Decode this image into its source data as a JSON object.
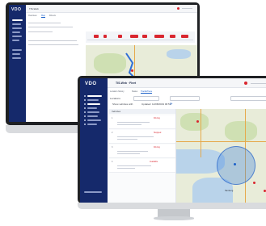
{
  "back_monitor": {
    "app_title": "TIS-Web",
    "logo": "VDO",
    "tabs": [
      "Overview",
      "Map",
      "Drivers"
    ],
    "nav_items": 9,
    "colors": {
      "sidebar": "#15296b",
      "accent": "#d9262f",
      "route": "#2f6fd6"
    }
  },
  "front_monitor": {
    "logo": "VDO",
    "app_title": "TIS-Web · Fleet",
    "breadcrumb": "Locations",
    "tabs": [
      "Location history",
      "Status",
      "Track&Trace"
    ],
    "active_tab": "Track&Trace",
    "filter_label": "Show vehicles with",
    "last_update": "Updated: 12/08/2019 06:53",
    "list_header": "Vehicles",
    "rows": [
      {
        "id": "1",
        "status": "Driving"
      },
      {
        "id": "2",
        "status": "Stopped"
      },
      {
        "id": "3",
        "status": "Driving"
      },
      {
        "id": "4",
        "status": "Available"
      }
    ],
    "map_city": "Hamburg",
    "colors": {
      "sidebar": "#15296b",
      "accent": "#1c61c9",
      "radius": "#4084dc",
      "alert": "#d9262f"
    }
  }
}
